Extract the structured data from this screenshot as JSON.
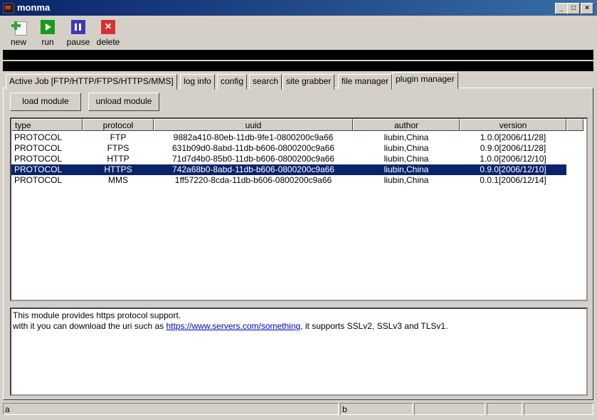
{
  "window": {
    "title": "monma"
  },
  "window_buttons": {
    "minimize": "_",
    "maximize": "□",
    "close": "×"
  },
  "toolbar": {
    "new_label": "new",
    "run_label": "run",
    "pause_label": "pause",
    "delete_label": "delete"
  },
  "icons": {
    "new": "plus-page-icon",
    "run": "play-icon",
    "pause": "pause-icon",
    "delete": "delete-x-icon"
  },
  "colors": {
    "new": "#2fa82f",
    "run": "#1a9a1a",
    "pause": "#3b3bb8",
    "delete": "#d83030",
    "selection": "#0a246a",
    "link": "#0000cc"
  },
  "tabs": [
    "Active Job [FTP/HTTP/FTPS/HTTPS/MMS]",
    "log info",
    "config",
    "search",
    "site grabber",
    "file manager",
    "plugin manager"
  ],
  "active_tab": "plugin manager",
  "actions": {
    "load_module": "load module",
    "unload_module": "unload module"
  },
  "columns": {
    "type": "type",
    "protocol": "protocol",
    "uuid": "uuid",
    "author": "author",
    "version": "version"
  },
  "rows": [
    {
      "type": "PROTOCOL",
      "protocol": "FTP",
      "uuid": "9882a410-80eb-11db-9fe1-0800200c9a66",
      "author": "liubin,China",
      "version": "1.0.0[2006/11/28]",
      "selected": false
    },
    {
      "type": "PROTOCOL",
      "protocol": "FTPS",
      "uuid": "631b09d0-8abd-11db-b606-0800200c9a66",
      "author": "liubin,China",
      "version": "0.9.0[2006/11/28]",
      "selected": false
    },
    {
      "type": "PROTOCOL",
      "protocol": "HTTP",
      "uuid": "71d7d4b0-85b0-11db-b606-0800200c9a66",
      "author": "liubin,China",
      "version": "1.0.0[2006/12/10]",
      "selected": false
    },
    {
      "type": "PROTOCOL",
      "protocol": "HTTPS",
      "uuid": "742a68b0-8abd-11db-b606-0800200c9a66",
      "author": "liubin,China",
      "version": "0.9.0[2006/12/10]",
      "selected": true
    },
    {
      "type": "PROTOCOL",
      "protocol": "MMS",
      "uuid": "1ff57220-8cda-11db-b606-0800200c9a66",
      "author": "liubin,China",
      "version": "0.0.1[2006/12/14]",
      "selected": false
    }
  ],
  "description": {
    "line1": "This module provides https protocol support.",
    "line2_prefix": "with it you can download the uri such as ",
    "link": "https://www.servers.com/something",
    "line2_suffix": ", it supports SSLv2, SSLv3 and TLSv1."
  },
  "statusbar": {
    "left": "a",
    "middle": "b"
  }
}
